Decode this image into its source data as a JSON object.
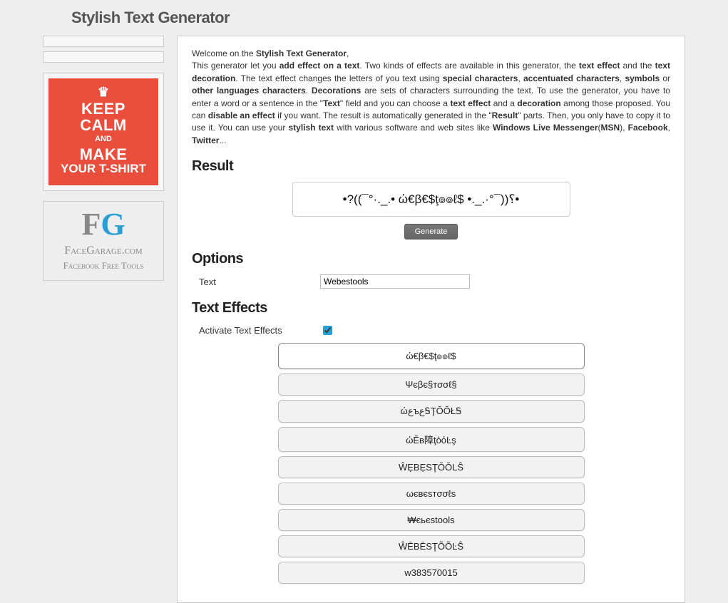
{
  "page_title": "Stylish Text Generator",
  "intro": {
    "p1a": "Welcome on the ",
    "p1b": "Stylish Text Generator",
    "p1c": ",",
    "p2a": "This generator let you ",
    "p2b": "add effect on a text",
    "p2c": ". Two kinds of effects are available in this generator, the ",
    "p2d": "text effect",
    "p2e": " and the ",
    "p2f": "text decoration",
    "p2g": ". The text effect changes the letters of you text using ",
    "p2h": "special characters",
    "p2i": ", ",
    "p2j": "accentuated characters",
    "p2k": ", ",
    "p2l": "symbols",
    "p2m": " or ",
    "p2n": "other languages characters",
    "p2o": ". ",
    "p2p": "Decorations",
    "p2q": " are sets of characters surrounding the text. To use the generator, you have to enter a word or a sentence in the \"",
    "p2r": "Text",
    "p2s": "\" field and you can choose a ",
    "p2t": "text effect",
    "p2u": " and a ",
    "p2v": "decoration",
    "p2w": " among those proposed. You can ",
    "p2x": "disable an effect",
    "p2y": " if you want. The result is automatically generated in the \"",
    "p2z": "Result",
    "p2aa": "\" parts. Then, you only have to copy it to use it. You can use your ",
    "p2ab": "stylish text",
    "p2ac": " with various software and web sites like ",
    "p2ad": "Windows Live Messenger",
    "p2ae": "(",
    "p2af": "MSN",
    "p2ag": "), ",
    "p2ah": "Facebook",
    "p2ai": ", ",
    "p2aj": "Twitter",
    "p2ak": "..."
  },
  "result": {
    "heading": "Result",
    "value": "•?((¯°·._.• ώ€β€$ţ๏๏ℓ$ •._.·°¯))؟•",
    "button": "Generate"
  },
  "options": {
    "heading": "Options",
    "text_label": "Text",
    "text_value": "Webestools"
  },
  "text_effects": {
    "heading": "Text Effects",
    "activate_label": "Activate Text Effects",
    "activate_checked": true,
    "items": [
      "ώ€β€$ţ๏๏ℓ$",
      "Ψєβє§тσσℓ§",
      "ώﻉъﻉᎦŢŎŎŁᎦ",
      "ώĔв障ţòόĿş",
      "ŴẸBẸSŢŎŎLŜ",
      "ωєвєѕтσσℓѕ",
      "₩єьєstools",
      "ŴĒBĒSŢÕÕĿŜ",
      "w383570015"
    ]
  },
  "sidebar": {
    "keep_calm": {
      "l1": "KEEP",
      "l2": "CALM",
      "l3": "AND",
      "l4": "MAKE",
      "l5": "YOUR T-SHIRT"
    },
    "fg": {
      "logo_f": "F",
      "logo_g": "G",
      "site": "FaceGarage.com",
      "tag": "Facebook Free Tools"
    }
  }
}
